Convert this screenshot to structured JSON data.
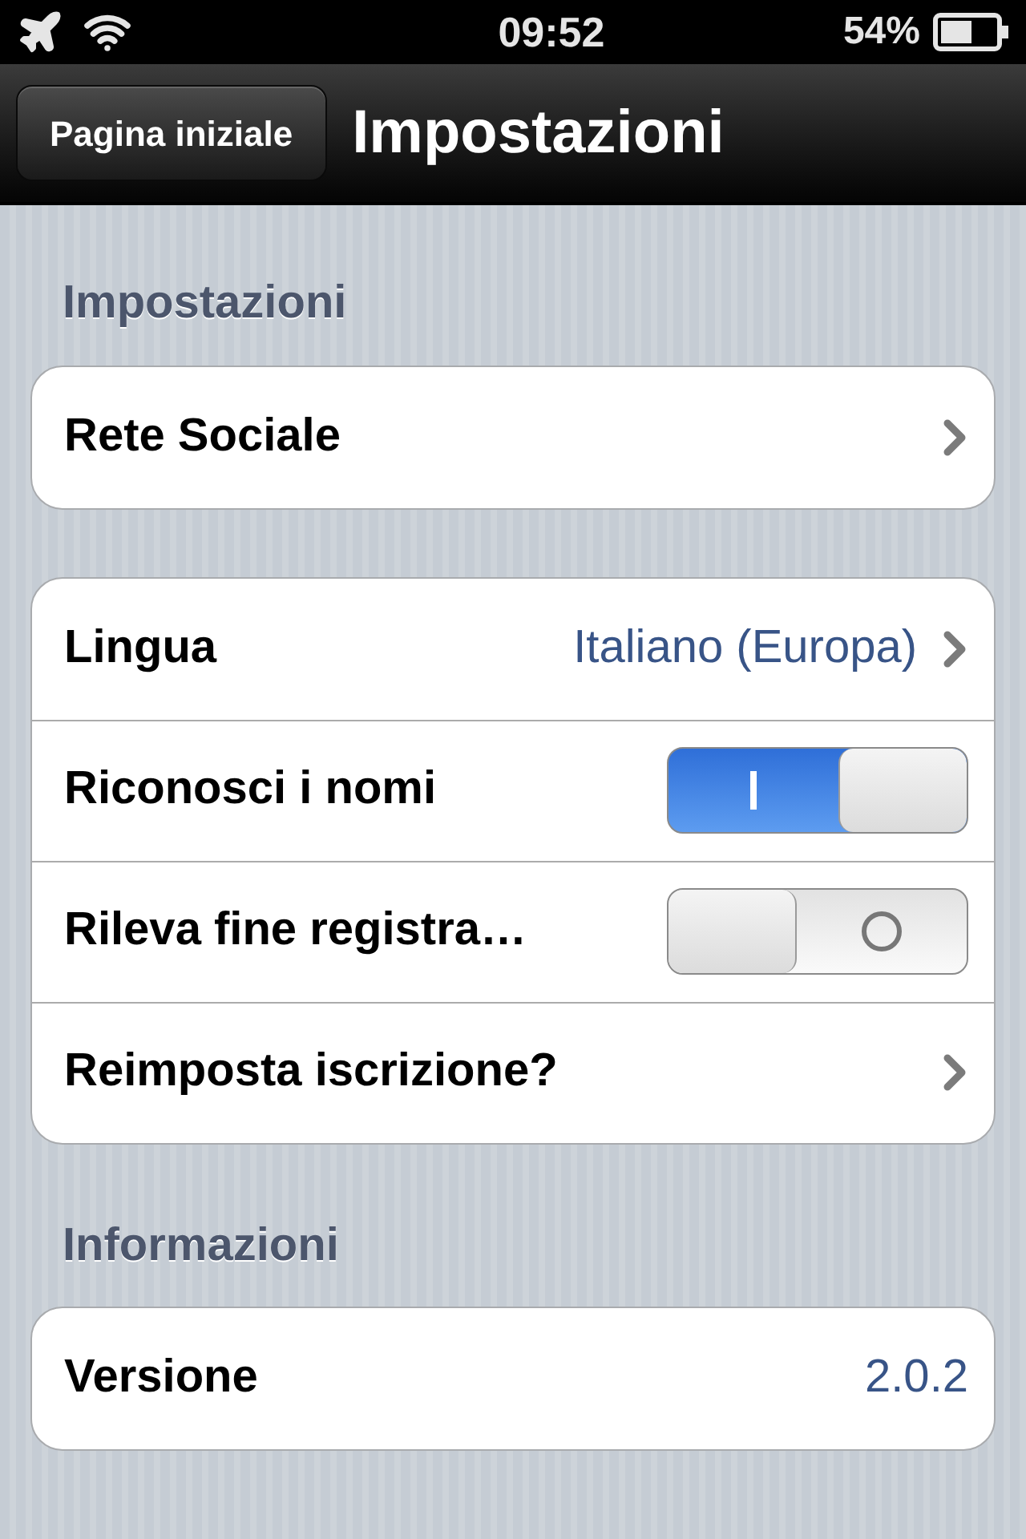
{
  "status_bar": {
    "time": "09:52",
    "battery": "54%"
  },
  "nav": {
    "back": "Pagina iniziale",
    "title": "Impostazioni"
  },
  "sections": [
    {
      "header": "Impostazioni",
      "rows": [
        {
          "kind": "link",
          "label": "Rete Sociale"
        }
      ]
    },
    {
      "rows": [
        {
          "kind": "link",
          "label": "Lingua",
          "value": "Italiano (Europa)"
        },
        {
          "kind": "switch",
          "label": "Riconosci i nomi",
          "on": true
        },
        {
          "kind": "switch",
          "label": "Rileva fine registra…",
          "on": false
        },
        {
          "kind": "link",
          "label": "Reimposta iscrizione?"
        }
      ]
    },
    {
      "header": "Informazioni",
      "rows": [
        {
          "kind": "value",
          "label": "Versione",
          "value": "2.0.2"
        }
      ]
    }
  ]
}
